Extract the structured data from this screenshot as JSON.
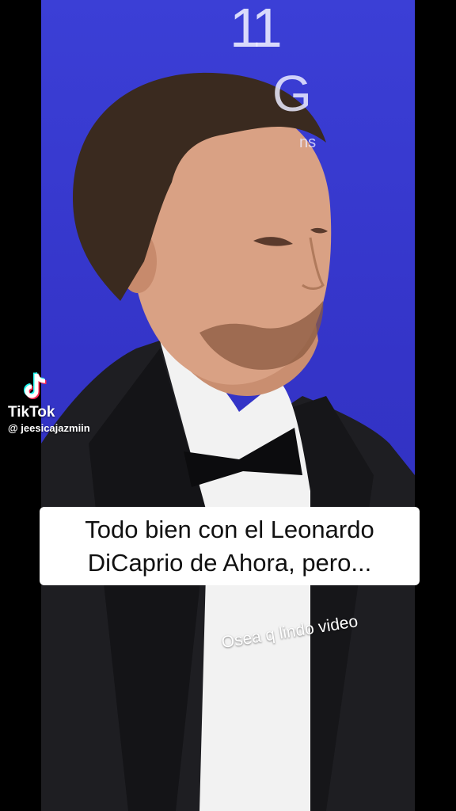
{
  "video": {
    "brand_mark": "11",
    "brand_letter": "G",
    "brand_sub": "ns"
  },
  "watermark": {
    "app_name": "TikTok",
    "handle": "@ jeesicajazmiin",
    "icon": "tiktok-logo-icon"
  },
  "caption": {
    "text": "Todo bien con el Leonardo\nDiCaprio de Ahora, pero..."
  },
  "overlay": {
    "text": "Osea q lindo video"
  },
  "colors": {
    "background": "#000000",
    "backdrop": "#3434c8",
    "caption_bg": "#ffffff",
    "caption_text": "#111111"
  }
}
